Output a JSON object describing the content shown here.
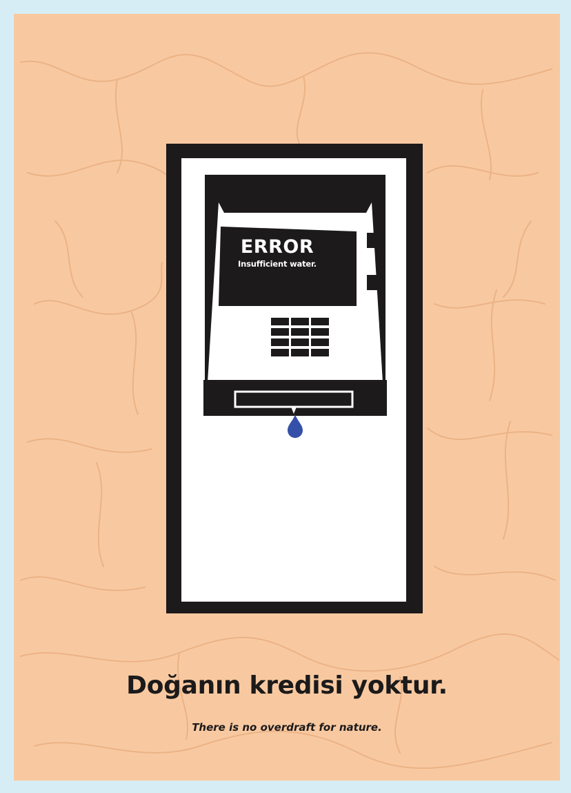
{
  "atm": {
    "screen_title": "ERROR",
    "screen_message": "Insufficient water."
  },
  "headline": "Doğanın kredisi yoktur.",
  "tagline": "There is no overdraft for nature.",
  "colors": {
    "background": "#f8c9a0",
    "frame": "#d7edf6",
    "ink": "#1c1a1b",
    "water": "#3550a8"
  },
  "icons": [
    "atm-icon",
    "water-drop-icon",
    "keypad-icon"
  ]
}
